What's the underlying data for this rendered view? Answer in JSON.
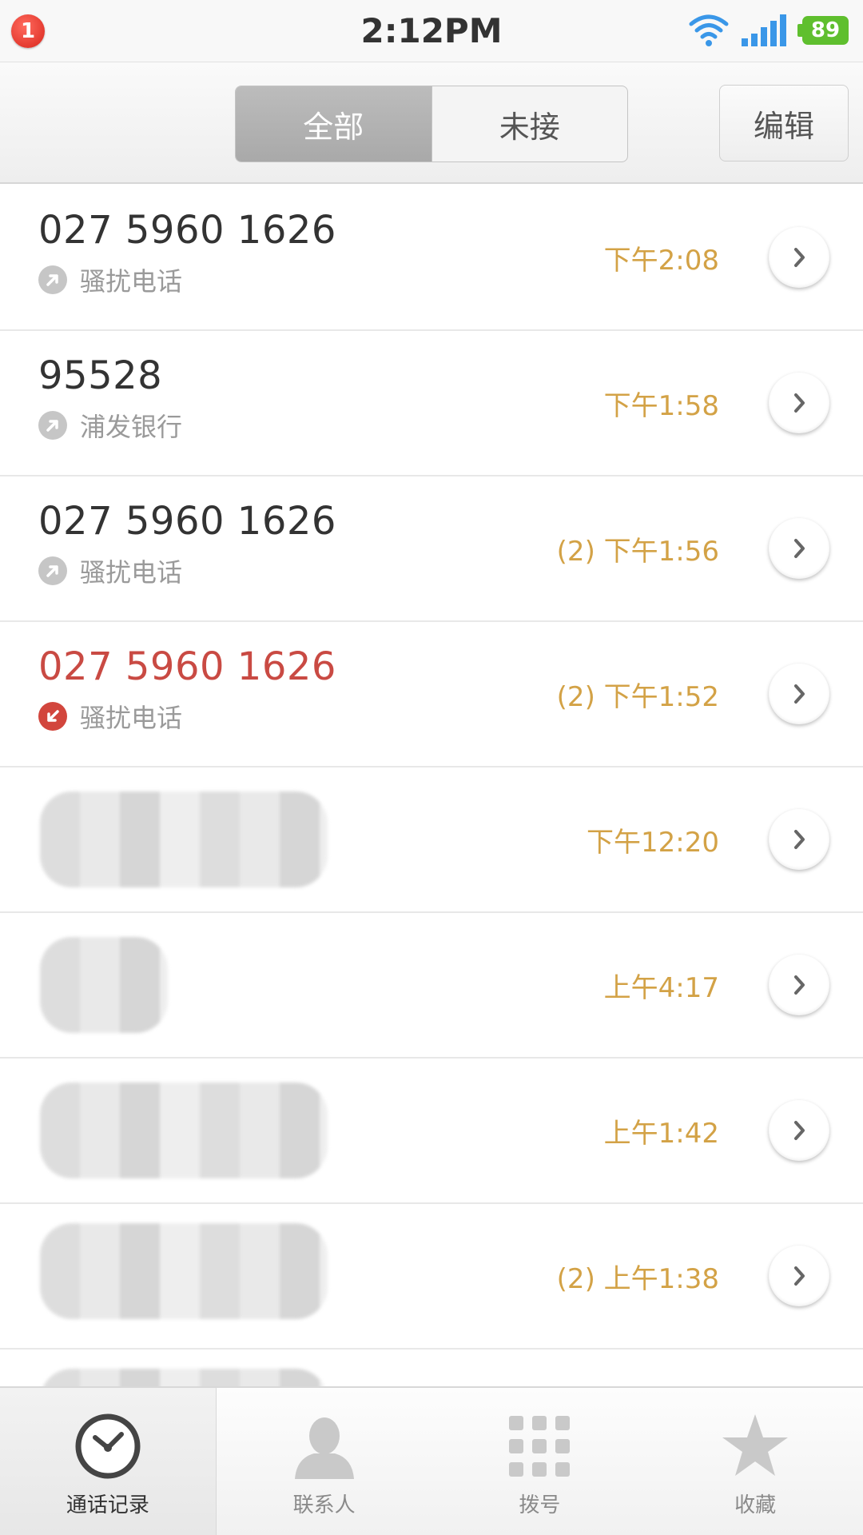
{
  "status_bar": {
    "notification_count": "1",
    "time": "2:12PM",
    "battery": "89"
  },
  "toolbar": {
    "tabs": [
      {
        "label": "全部",
        "selected": true
      },
      {
        "label": "未接",
        "selected": false
      }
    ],
    "edit_label": "编辑"
  },
  "calls": [
    {
      "number": "027 5960 1626",
      "label": "骚扰电话",
      "time": "下午2:08",
      "missed": false
    },
    {
      "number": "95528",
      "label": "浦发银行",
      "time": "下午1:58",
      "missed": false
    },
    {
      "number": "027 5960 1626",
      "label": "骚扰电话",
      "time": "(2) 下午1:56",
      "missed": false
    },
    {
      "number": "027 5960 1626",
      "label": "骚扰电话",
      "time": "(2) 下午1:52",
      "missed": true
    },
    {
      "number": "",
      "label": "",
      "time": "下午12:20",
      "missed": false,
      "redacted": true
    },
    {
      "number": "",
      "label": "",
      "time": "上午4:17",
      "missed": false,
      "redacted": true
    },
    {
      "number": "",
      "label": "",
      "time": "上午1:42",
      "missed": false,
      "redacted": true
    },
    {
      "number": "",
      "label": "",
      "time": "(2) 上午1:38",
      "missed": false,
      "redacted": true
    }
  ],
  "bottom_nav": [
    {
      "label": "通话记录",
      "icon": "clock-icon",
      "active": true
    },
    {
      "label": "联系人",
      "icon": "person-icon",
      "active": false
    },
    {
      "label": "拨号",
      "icon": "dialpad-icon",
      "active": false
    },
    {
      "label": "收藏",
      "icon": "star-icon",
      "active": false
    }
  ],
  "colors": {
    "time_text": "#d3a246",
    "missed_red": "#c94a43",
    "label_gray": "#9a9a9a"
  }
}
